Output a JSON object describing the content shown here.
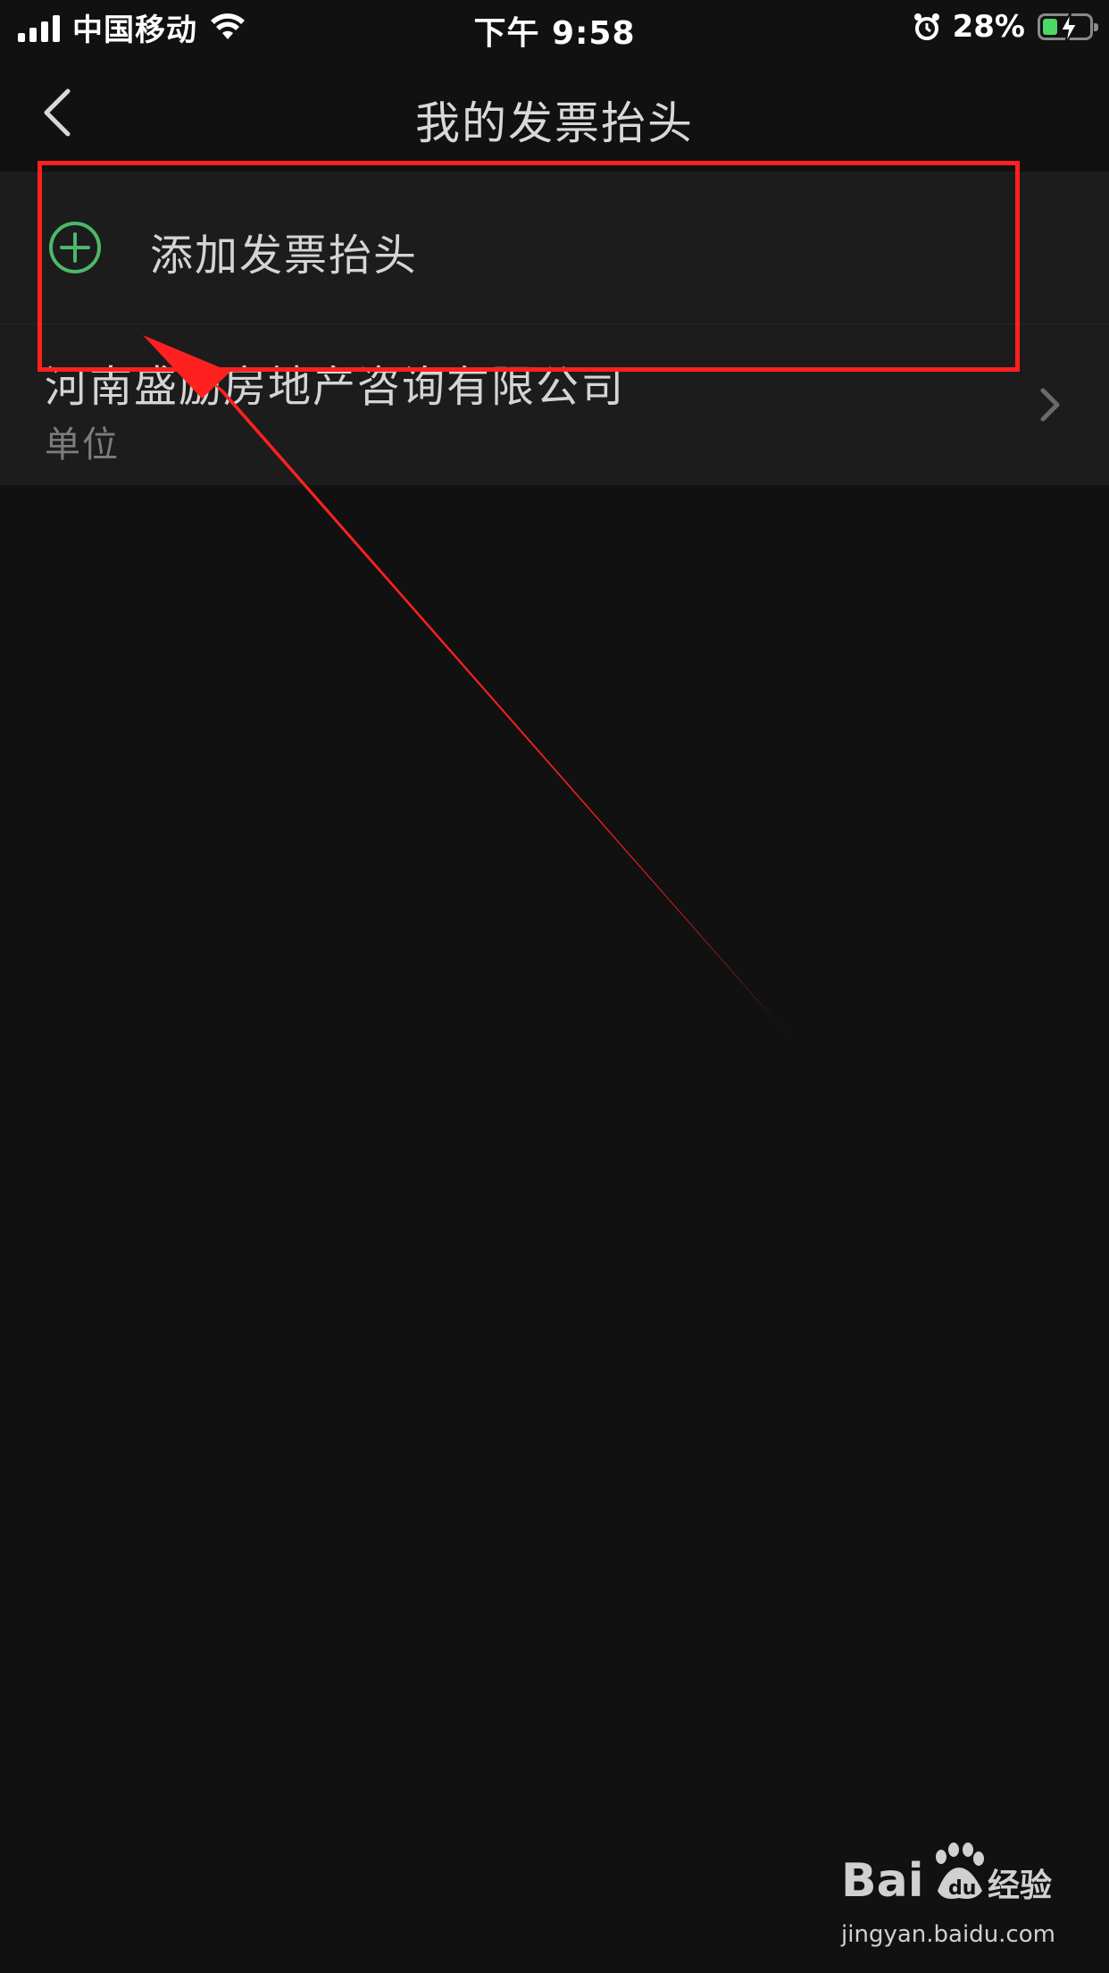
{
  "status_bar": {
    "carrier": "中国移动",
    "time": "下午 9:58",
    "battery_percent": "28%",
    "icons": [
      "signal-icon",
      "wifi-icon",
      "alarm-icon",
      "battery-charging-icon"
    ]
  },
  "nav": {
    "title": "我的发票抬头",
    "back_icon": "chevron-left-icon"
  },
  "add_row": {
    "label": "添加发票抬头",
    "icon": "plus-circle-icon",
    "icon_color": "#4cb86a"
  },
  "invoice_titles": [
    {
      "name": "河南盛励房地产咨询有限公司",
      "type": "单位",
      "icon": "chevron-right-icon"
    }
  ],
  "annotation": {
    "color": "#ff2020"
  },
  "watermark": {
    "logo_text": "Bai 经验",
    "url": "jingyan.baidu.com"
  },
  "colors": {
    "background": "#111111",
    "list_background": "#1c1c1c",
    "primary_text": "#d4d4d4",
    "secondary_text": "#7d7d7d",
    "accent_green": "#4cb86a"
  }
}
